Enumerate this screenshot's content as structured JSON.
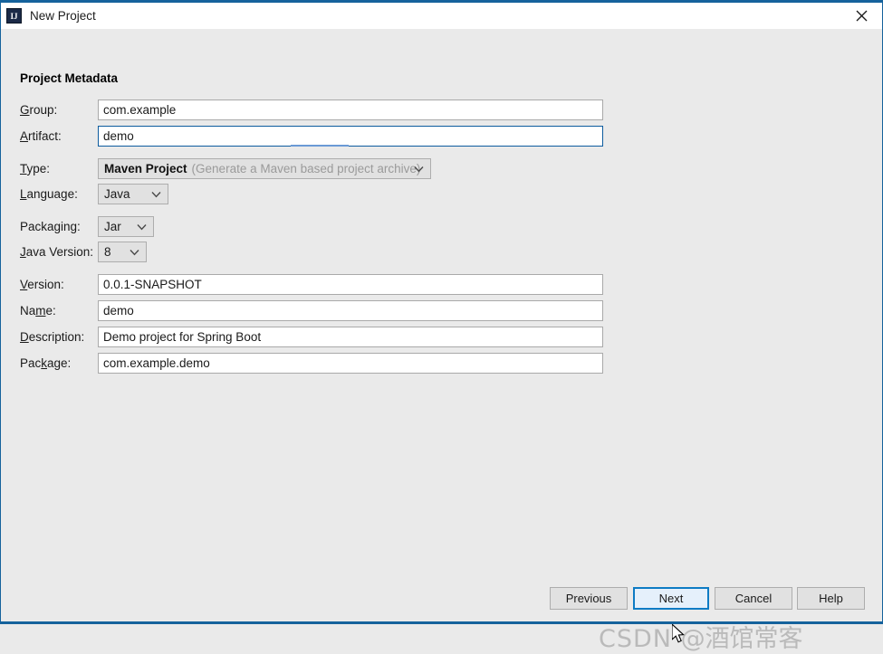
{
  "window": {
    "title": "New Project",
    "app_icon": "IJ",
    "close_icon": "close-icon",
    "accent_color": "#15629c",
    "background_color": "#eaeaea",
    "titlebar_color": "#ffffff"
  },
  "section": {
    "title": "Project Metadata"
  },
  "fields": {
    "group": {
      "label": "Group:",
      "mnemonic": "G",
      "value": "com.example",
      "focused": false
    },
    "artifact": {
      "label": "Artifact:",
      "mnemonic": "A",
      "value": "demo",
      "focused": true
    },
    "version": {
      "label": "Version:",
      "mnemonic": "V",
      "value": "0.0.1-SNAPSHOT",
      "focused": false
    },
    "name": {
      "label": "Name:",
      "mnemonic": "m",
      "value": "demo",
      "focused": false
    },
    "description": {
      "label": "Description:",
      "mnemonic": "D",
      "value": "Demo project for Spring Boot",
      "focused": false
    },
    "package": {
      "label": "Package:",
      "mnemonic": "k",
      "value": "com.example.demo",
      "focused": false
    }
  },
  "combos": {
    "type": {
      "label": "Type:",
      "mnemonic": "T",
      "value": "Maven Project",
      "hint": "(Generate a Maven based project archive)",
      "arrow_icon": "chevron-down-icon"
    },
    "language": {
      "label": "Language:",
      "mnemonic": "L",
      "value": "Java",
      "arrow_icon": "chevron-down-icon"
    },
    "packaging": {
      "label": "Packaging:",
      "mnemonic": "g",
      "value": "Jar",
      "arrow_icon": "chevron-down-icon"
    },
    "java_version": {
      "label": "Java Version:",
      "mnemonic": "J",
      "value": "8",
      "arrow_icon": "chevron-down-icon"
    }
  },
  "buttons": {
    "previous": "Previous",
    "next": "Next",
    "cancel": "Cancel",
    "help": "Help",
    "default_button": "next"
  },
  "watermark": {
    "prefix": "CSDN ",
    "handle": "@酒馆常客"
  }
}
